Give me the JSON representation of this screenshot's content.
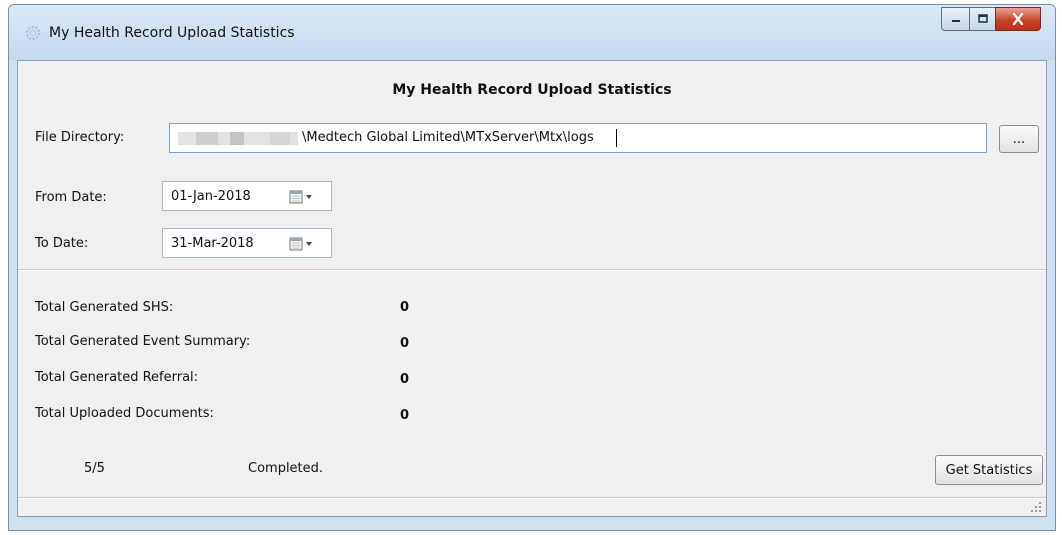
{
  "window": {
    "title": "My Health Record Upload Statistics"
  },
  "form": {
    "heading": "My Health Record Upload Statistics",
    "file_directory_label": "File Directory:",
    "file_directory_value": "\\Medtech Global Limited\\MTxServer\\Mtx\\logs",
    "browse_label": "...",
    "from_date_label": "From Date:",
    "from_date_value": "01-Jan-2018",
    "to_date_label": "To Date:",
    "to_date_value": "31-Mar-2018"
  },
  "stats": [
    {
      "label": "Total Generated SHS:",
      "value": "0"
    },
    {
      "label": "Total Generated Event Summary:",
      "value": "0"
    },
    {
      "label": "Total Generated Referral:",
      "value": "0"
    },
    {
      "label": "Total Uploaded Documents:",
      "value": "0"
    }
  ],
  "footer": {
    "progress_text": "5/5",
    "status_text": "Completed.",
    "get_statistics_label": "Get Statistics"
  },
  "colors": {
    "close_button": "#c8452b",
    "title_bar": "#c5d9ee",
    "client_bg": "#f0f0f0"
  }
}
